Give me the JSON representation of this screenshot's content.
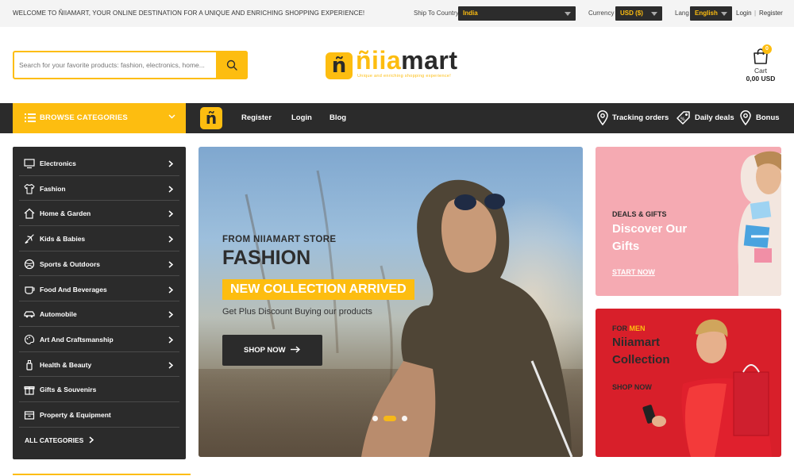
{
  "topbar": {
    "welcome": "WELCOME TO ÑIIAMART, YOUR ONLINE DESTINATION FOR A UNIQUE AND ENRICHING SHOPPING EXPERIENCE!",
    "ship_label": "Ship To Country",
    "ship_value": "India",
    "currency_label": "Currency",
    "currency_value": "USD ($)",
    "lang_label": "Lang",
    "lang_value": "English",
    "login": "Login",
    "separator": "|",
    "register": "Register"
  },
  "search": {
    "placeholder": "Search for your favorite products: fashion, electronics, home..."
  },
  "logo": {
    "badge_letter": "ñ",
    "name_accent": "ñiia",
    "name_rest": "mart",
    "tagline": "Unique and enriching shopping experience!"
  },
  "cart": {
    "count": "0",
    "label": "Cart",
    "total": "0,00 USD"
  },
  "nav": {
    "browse_label": "BROWSE CATEGORIES",
    "links": [
      "Register",
      "Login",
      "Blog"
    ],
    "right": [
      "Tracking orders",
      "Daily deals",
      "Bonus"
    ]
  },
  "categories": [
    {
      "label": "Electronics",
      "icon": "monitor-icon"
    },
    {
      "label": "Fashion",
      "icon": "tshirt-icon"
    },
    {
      "label": "Home & Garden",
      "icon": "home-icon"
    },
    {
      "label": "Kids & Babies",
      "icon": "plane-icon"
    },
    {
      "label": "Sports & Outdoors",
      "icon": "ball-icon"
    },
    {
      "label": "Food And Beverages",
      "icon": "cup-icon"
    },
    {
      "label": "Automobile",
      "icon": "car-icon"
    },
    {
      "label": "Art And Craftsmanship",
      "icon": "palette-icon"
    },
    {
      "label": "Health & Beauty",
      "icon": "bottle-icon"
    },
    {
      "label": "Gifts & Souvenirs",
      "icon": "gift-icon"
    },
    {
      "label": "Property & Equipment",
      "icon": "box-icon"
    }
  ],
  "all_categories": "ALL CATEGORIES",
  "hero": {
    "pre": "FROM NIIAMART STORE",
    "title": "FASHION",
    "tag": "NEW COLLECTION ARRIVED",
    "subtitle": "Get Plus Discount Buying our products",
    "button": "SHOP NOW",
    "slides": 3,
    "active_slide": 2
  },
  "banner1": {
    "pre": "DEALS & GIFTS",
    "title": "Discover Our Gifts",
    "link": "START NOW"
  },
  "banner2": {
    "pre_a": "FOR ",
    "pre_b": "MEN",
    "title": "Niiamart Collection",
    "link": "SHOP NOW"
  },
  "colors": {
    "accent": "#fdbd10",
    "dark": "#2b2b2b",
    "banner1_bg": "#f5aab2",
    "banner2_bg": "#d81f2a"
  }
}
